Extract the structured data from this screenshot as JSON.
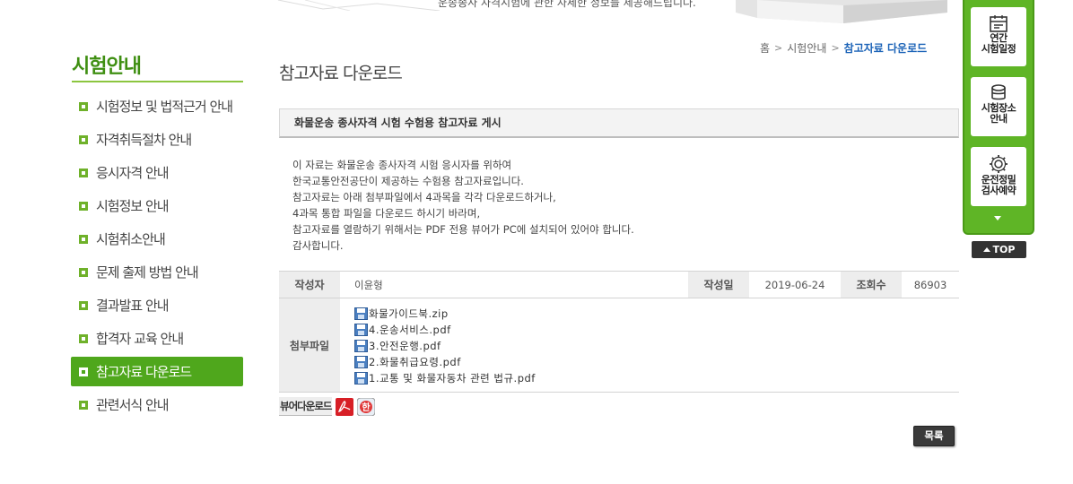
{
  "banner": {
    "text": "운송종사 자격시험에 관한 자세한 정보를 제공해드립니다."
  },
  "sidebar": {
    "title": "시험안내",
    "items": [
      {
        "label": "시험정보 및 법적근거 안내",
        "active": false
      },
      {
        "label": "자격취득절차 안내",
        "active": false
      },
      {
        "label": "응시자격 안내",
        "active": false
      },
      {
        "label": "시험정보 안내",
        "active": false
      },
      {
        "label": "시험취소안내",
        "active": false
      },
      {
        "label": "문제 출제 방법 안내",
        "active": false
      },
      {
        "label": "결과발표 안내",
        "active": false
      },
      {
        "label": "합격자 교육 안내",
        "active": false
      },
      {
        "label": "참고자료 다운로드",
        "active": true
      },
      {
        "label": "관련서식 안내",
        "active": false
      }
    ]
  },
  "breadcrumb": {
    "home": "홈",
    "section": "시험안내",
    "current": "참고자료 다운로드"
  },
  "page": {
    "title": "참고자료 다운로드"
  },
  "post": {
    "subject": "화물운송 종사자격 시험 수험용 참고자료 게시",
    "body": [
      "이 자료는 화물운송 종사자격 시험 응시자를 위하여",
      "한국교통안전공단이 제공하는 수험용 참고자료입니다.",
      "참고자료는 아래 첨부파일에서 4과목을 각각 다운로드하거나,",
      "4과목 통합 파일을 다운로드 하시기 바라며,",
      "참고자료를 열람하기 위해서는 PDF 전용 뷰어가 PC에 설치되어 있어야 합니다.",
      "감사합니다."
    ],
    "author_label": "작성자",
    "author": "이윤형",
    "date_label": "작성일",
    "date": "2019-06-24",
    "views_label": "조회수",
    "views": "86903",
    "attach_label": "첨부파일",
    "files": [
      "화물가이드북.zip",
      "4.운송서비스.pdf",
      "3.안전운행.pdf",
      "2.화물취급요령.pdf",
      "1.교통 및 화물자동차 관련 법규.pdf"
    ]
  },
  "viewer": {
    "label": "뷰어다운로드",
    "icons": [
      "adobe-pdf-icon",
      "hangul-viewer-icon"
    ]
  },
  "buttons": {
    "list": "목록",
    "top": "TOP"
  },
  "quick_menu": {
    "items": [
      {
        "label": "연간\n시험일정",
        "icon": "calendar-icon"
      },
      {
        "label": "시험장소\n안내",
        "icon": "location-icon"
      },
      {
        "label": "운전정밀\n검사예약",
        "icon": "gear-icon"
      }
    ]
  },
  "colors": {
    "accent_green": "#4fa71c",
    "breadcrumb_current": "#1a62b7"
  }
}
